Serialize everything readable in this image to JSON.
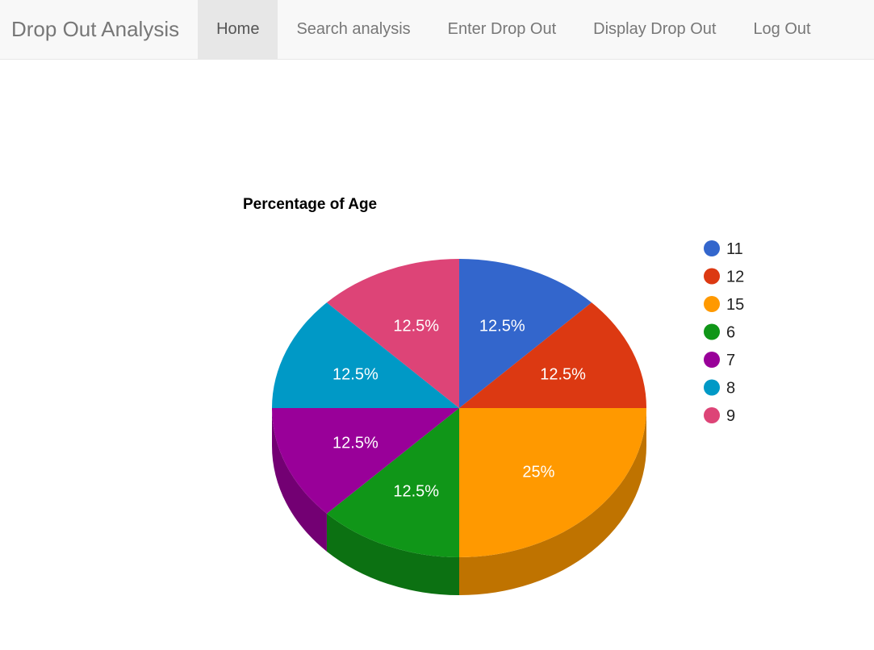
{
  "navbar": {
    "brand": "Drop Out Analysis",
    "items": [
      {
        "label": "Home",
        "active": true
      },
      {
        "label": "Search analysis",
        "active": false
      },
      {
        "label": "Enter Drop Out",
        "active": false
      },
      {
        "label": "Display Drop Out",
        "active": false
      },
      {
        "label": "Log Out",
        "active": false
      }
    ]
  },
  "chart_data": {
    "type": "pie",
    "title": "Percentage of Age",
    "is3D": true,
    "legend_position": "right",
    "categories": [
      "11",
      "12",
      "15",
      "6",
      "7",
      "8",
      "9"
    ],
    "values": [
      1,
      1,
      2,
      1,
      1,
      1,
      1
    ],
    "labels": [
      "12.5%",
      "12.5%",
      "25%",
      "12.5%",
      "12.5%",
      "12.5%",
      "12.5%"
    ],
    "colors": [
      "#3366cc",
      "#dc3912",
      "#ff9900",
      "#109618",
      "#990099",
      "#0099c6",
      "#dd4477"
    ]
  }
}
